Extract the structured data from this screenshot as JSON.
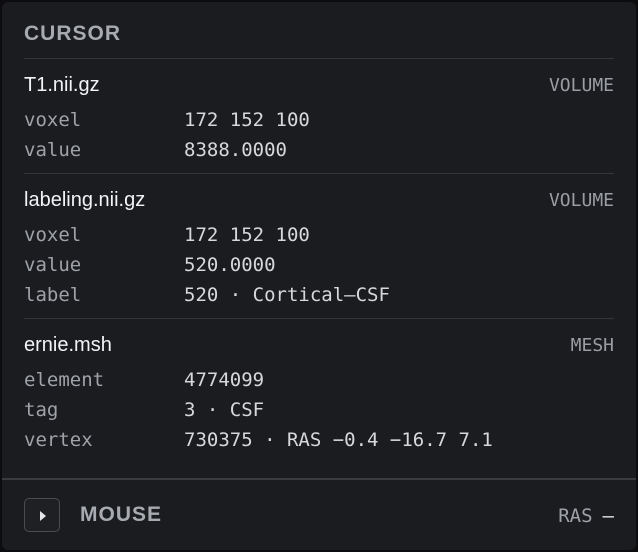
{
  "cursor": {
    "title": "CURSOR",
    "layers": [
      {
        "name": "T1.nii.gz",
        "kind": "VOLUME",
        "rows": [
          {
            "key": "voxel",
            "value": "172 152 100"
          },
          {
            "key": "value",
            "value": "8388.0000"
          }
        ]
      },
      {
        "name": "labeling.nii.gz",
        "kind": "VOLUME",
        "rows": [
          {
            "key": "voxel",
            "value": "172 152 100"
          },
          {
            "key": "value",
            "value": "520.0000"
          },
          {
            "key": "label",
            "value": "520 · Cortical–CSF"
          }
        ]
      },
      {
        "name": "ernie.msh",
        "kind": "MESH",
        "rows": [
          {
            "key": "element",
            "value": "4774099"
          },
          {
            "key": "tag",
            "value": "3 · CSF"
          },
          {
            "key": "vertex",
            "value": "730375 · RAS −0.4 −16.7 7.1"
          }
        ]
      }
    ]
  },
  "mouse": {
    "title": "MOUSE",
    "frame_label": "RAS",
    "frame_value": "—",
    "expand_icon": "chevron-right-icon"
  }
}
